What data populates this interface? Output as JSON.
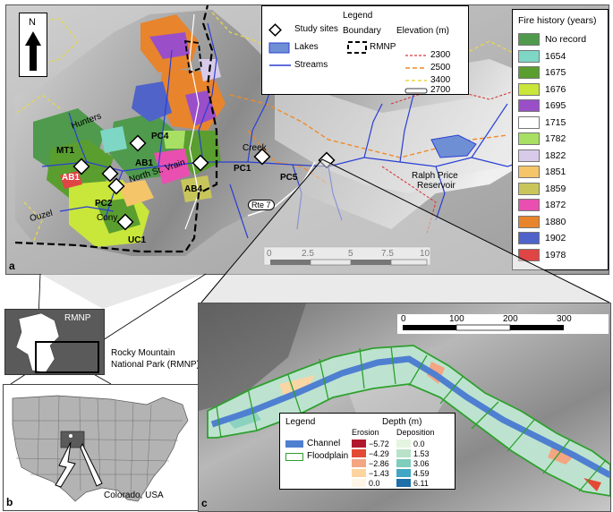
{
  "panel_labels": {
    "a": "a",
    "b": "b",
    "c": "c"
  },
  "legend_a": {
    "title": "Legend",
    "study_sites": "Study sites",
    "lakes": "Lakes",
    "streams": "Streams",
    "boundary_title": "Boundary",
    "boundary_label": "RMNP",
    "elevation_title": "Elevation (m)",
    "elevations": [
      "2300",
      "2500",
      "3400",
      "2700"
    ]
  },
  "fire_history": {
    "title": "Fire history (years)",
    "items": [
      {
        "label": "No record",
        "color": "#4f9a4c"
      },
      {
        "label": "1654",
        "color": "#7dd7c4"
      },
      {
        "label": "1675",
        "color": "#5a9e2f"
      },
      {
        "label": "1676",
        "color": "#c9e63a"
      },
      {
        "label": "1695",
        "color": "#9a4fc9"
      },
      {
        "label": "1715",
        "color": "#ffffff"
      },
      {
        "label": "1782",
        "color": "#a7e063"
      },
      {
        "label": "1822",
        "color": "#d8cbe9"
      },
      {
        "label": "1851",
        "color": "#f5c56a"
      },
      {
        "label": "1859",
        "color": "#c8c65a"
      },
      {
        "label": "1872",
        "color": "#e84fb0"
      },
      {
        "label": "1880",
        "color": "#e8842c"
      },
      {
        "label": "1902",
        "color": "#4f63c9"
      },
      {
        "label": "1978",
        "color": "#e04545"
      }
    ]
  },
  "site_labels": {
    "mt1": "MT1",
    "ab1": "AB1",
    "ab1b": "AB1",
    "pc4": "PC4",
    "pc2": "PC2",
    "uc1": "UC1",
    "ab4": "AB4",
    "pc1": "PC1",
    "pc5": "PC5"
  },
  "place_labels": {
    "hunters": "Hunters",
    "creek_north": "Creek",
    "north_st_vrain": "North St. Vrain",
    "cony": "Cony",
    "ouzel": "Ouzel",
    "ralph": "Ralph Price",
    "reservoir": "Reservoir",
    "rte7": "Rte 7"
  },
  "scale_a": {
    "ticks": [
      "0",
      "2.5",
      "5",
      "7.5",
      "10"
    ]
  },
  "scale_c": {
    "ticks": [
      "0",
      "100",
      "200",
      "300"
    ]
  },
  "inset": {
    "rmnp_label": "RMNP",
    "park_name_line1": "Rocky Mountain",
    "park_name_line2": "National Park (RMNP)",
    "state_label": "Colorado, USA"
  },
  "legend_c": {
    "title": "Legend",
    "channel": "Channel",
    "floodplain": "Floodplain",
    "depth_title": "Depth (m)",
    "erosion_title": "Erosion",
    "deposition_title": "Deposition",
    "erosion": [
      {
        "label": "−5.72",
        "color": "#b2182b"
      },
      {
        "label": "−4.29",
        "color": "#e34a33"
      },
      {
        "label": "−2.86",
        "color": "#f4a582"
      },
      {
        "label": "−1.43",
        "color": "#fdd49e"
      },
      {
        "label": "0.0",
        "color": "#fff5e6"
      }
    ],
    "deposition": [
      {
        "label": "0.0",
        "color": "#e5f5e0"
      },
      {
        "label": "1.53",
        "color": "#b8e3c9"
      },
      {
        "label": "3.06",
        "color": "#7fcdbb"
      },
      {
        "label": "4.59",
        "color": "#41a6c4"
      },
      {
        "label": "6.11",
        "color": "#1d6fa8"
      }
    ]
  }
}
